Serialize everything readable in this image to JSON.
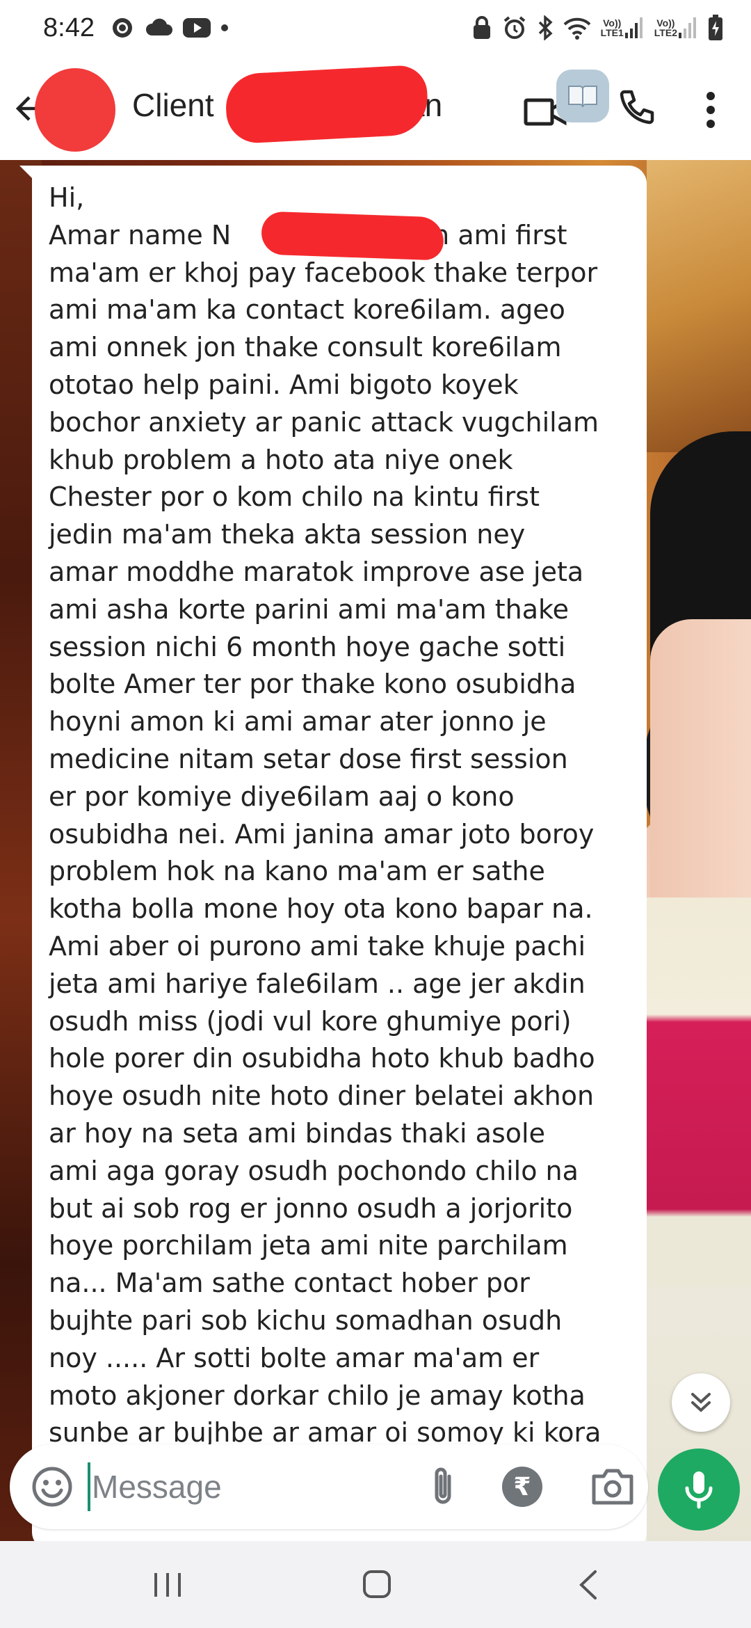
{
  "status_bar": {
    "time": "8:42",
    "sim1_label_top": "Vo))",
    "sim1_label_bottom": "LTE1",
    "sim2_label_top": "Vo))",
    "sim2_label_bottom": "LTE2"
  },
  "header": {
    "title_prefix": "Client",
    "title_suffix": "an"
  },
  "message": {
    "text": "Hi,\nAmar name N                        n ami first\nma'am er khoj pay facebook thake terpor\nami ma'am ka contact kore6ilam. ageo\nami onnek jon thake consult kore6ilam\nototao help paini. Ami bigoto koyek\nbochor anxiety ar panic attack vugchilam\nkhub problem a hoto ata niye onek\nChester por o kom chilo na kintu first\njedin ma'am theka akta session ney\namar moddhe maratok improve ase jeta\nami asha korte parini ami ma'am thake\nsession nichi 6 month hoye gache sotti\nbolte Amer ter por thake kono osubidha\nhoyni amon ki ami amar ater jonno je\nmedicine nitam setar dose first session\ner por komiye diye6ilam aaj o kono\nosubidha nei. Ami janina amar joto boroy\nproblem hok na kano ma'am er sathe\nkotha bolla mone hoy ota kono bapar na.\nAmi aber oi purono ami take khuje pachi\njeta ami hariye fale6ilam .. age jer akdin\nosudh miss (jodi vul kore ghumiye pori)\nhole porer din osubidha hoto khub badho\nhoye osudh nite hoto diner belatei akhon\nar hoy na seta ami bindas thaki asole\nami aga goray osudh pochondo chilo na\nbut ai sob rog er jonno osudh a jorjorito\nhoye porchilam jeta ami nite parchilam\nna... Ma'am sathe contact hober por\nbujhte pari sob kichu somadhan osudh\nnoy ..... Ar sotti bolte amar ma'am er\nmoto akjoner dorkar chilo je amay kotha\nsunbe ar bujhbe ar amar oi somoy ki kora"
  },
  "composer": {
    "placeholder": "Message",
    "rupee_symbol": "₹"
  },
  "colors": {
    "accent_green": "#1eaa62",
    "redaction_red": "#f5292d",
    "bubble_bg": "#ffffff"
  },
  "icons": {
    "back": "arrow-left-icon",
    "video": "video-camera-icon",
    "call": "phone-icon",
    "more": "more-vertical-icon",
    "emoji": "emoji-icon",
    "attach": "paperclip-icon",
    "payment": "rupee-icon",
    "camera": "camera-icon",
    "mic": "microphone-icon",
    "scroll_down": "double-chevron-down-icon"
  }
}
